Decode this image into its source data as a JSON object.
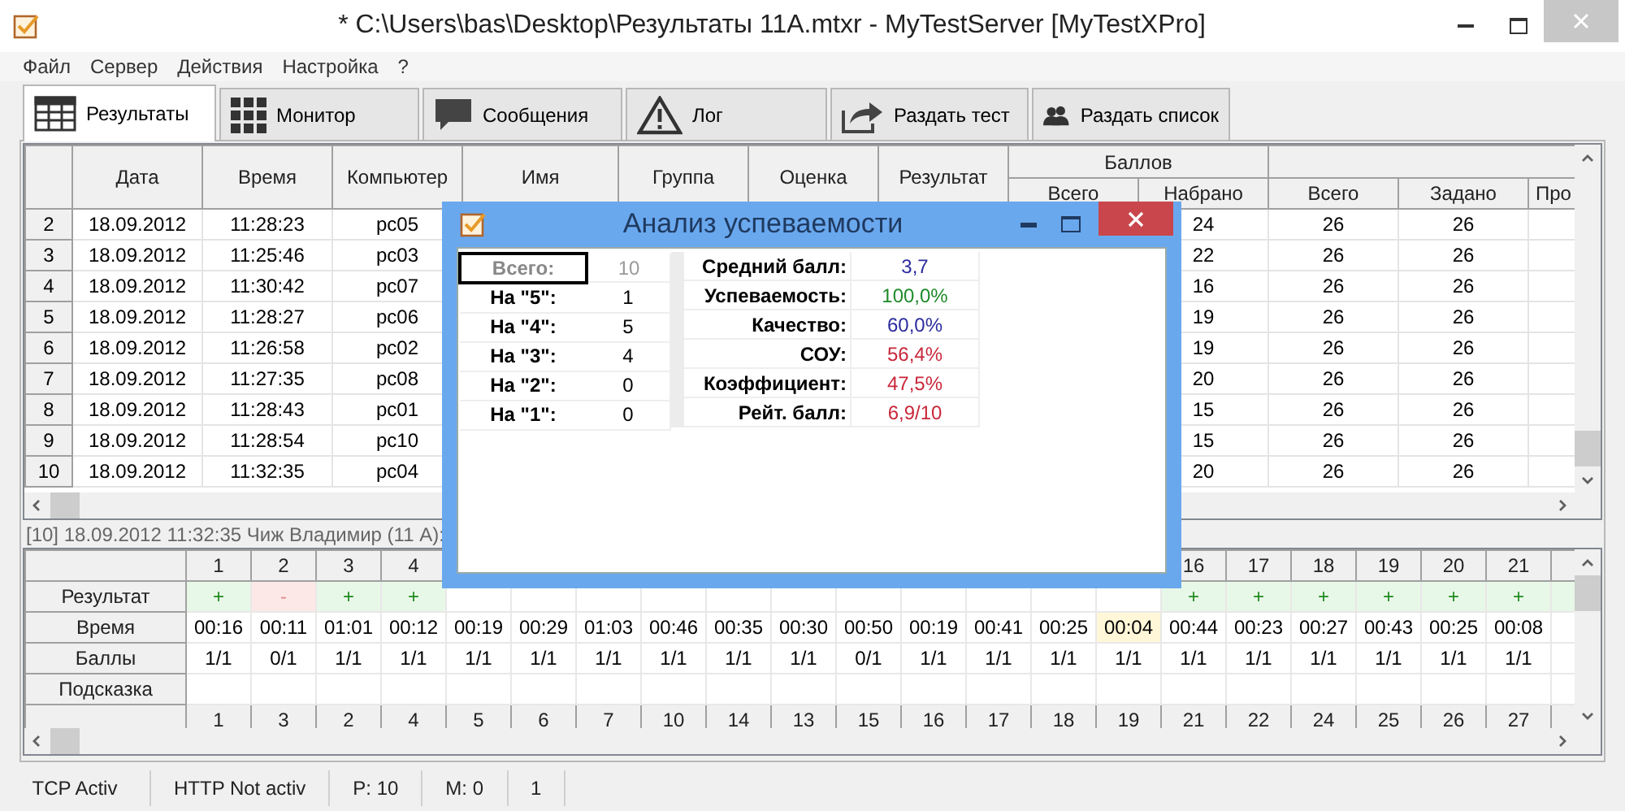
{
  "window": {
    "title": "* C:\\Users\\bas\\Desktop\\Результаты 11А.mtxr - MyTestServer [MyTestXPro]"
  },
  "menu": [
    "Файл",
    "Сервер",
    "Действия",
    "Настройка",
    "?"
  ],
  "tabs": [
    {
      "label": "Результаты",
      "selected": true
    },
    {
      "label": "Монитор",
      "selected": false
    },
    {
      "label": "Сообщения",
      "selected": false
    },
    {
      "label": "Лог",
      "selected": false
    },
    {
      "label": "Раздать тест",
      "selected": false
    },
    {
      "label": "Раздать список",
      "selected": false
    }
  ],
  "results_table": {
    "columns": [
      "Дата",
      "Время",
      "Компьютер",
      "Имя",
      "Группа",
      "Оценка",
      "Результат"
    ],
    "group_header": "Баллов",
    "group_columns": [
      "Всего",
      "Набрано"
    ],
    "extra_columns": [
      "Всего",
      "Задано",
      "Про"
    ],
    "rows": [
      {
        "number": "2",
        "date": "18.09.2012",
        "time": "11:28:23",
        "computer": "pc05",
        "scored": "24",
        "total": "26",
        "assigned": "26"
      },
      {
        "number": "3",
        "date": "18.09.2012",
        "time": "11:25:46",
        "computer": "pc03",
        "scored": "22",
        "total": "26",
        "assigned": "26"
      },
      {
        "number": "4",
        "date": "18.09.2012",
        "time": "11:30:42",
        "computer": "pc07",
        "scored": "16",
        "total": "26",
        "assigned": "26"
      },
      {
        "number": "5",
        "date": "18.09.2012",
        "time": "11:28:27",
        "computer": "pc06",
        "scored": "19",
        "total": "26",
        "assigned": "26"
      },
      {
        "number": "6",
        "date": "18.09.2012",
        "time": "11:26:58",
        "computer": "pc02",
        "scored": "19",
        "total": "26",
        "assigned": "26"
      },
      {
        "number": "7",
        "date": "18.09.2012",
        "time": "11:27:35",
        "computer": "pc08",
        "scored": "20",
        "total": "26",
        "assigned": "26"
      },
      {
        "number": "8",
        "date": "18.09.2012",
        "time": "11:28:43",
        "computer": "pc01",
        "scored": "15",
        "total": "26",
        "assigned": "26"
      },
      {
        "number": "9",
        "date": "18.09.2012",
        "time": "11:28:54",
        "computer": "pc10",
        "scored": "15",
        "total": "26",
        "assigned": "26"
      },
      {
        "number": "10",
        "date": "18.09.2012",
        "time": "11:32:35",
        "computer": "pc04",
        "scored": "20",
        "total": "26",
        "assigned": "26"
      }
    ]
  },
  "record_caption": "[10] 18.09.2012 11:32:35  Чиж Владимир (11 А):",
  "answers": {
    "row_labels": [
      "Результат",
      "Время",
      "Баллы",
      "Подсказка"
    ],
    "questions": [
      {
        "number": "1",
        "result": "+",
        "correct": true,
        "time": "00:16",
        "highlighted": false,
        "score": "1/1",
        "order": "1"
      },
      {
        "number": "2",
        "result": "-",
        "correct": false,
        "time": "00:11",
        "highlighted": false,
        "score": "0/1",
        "order": "3"
      },
      {
        "number": "3",
        "result": "+",
        "correct": true,
        "time": "01:01",
        "highlighted": false,
        "score": "1/1",
        "order": "2"
      },
      {
        "number": "4",
        "result": "+",
        "correct": true,
        "time": "00:12",
        "highlighted": false,
        "score": "1/1",
        "order": "4"
      },
      {
        "time": "00:19",
        "highlighted": false,
        "score": "1/1",
        "order": "5"
      },
      {
        "time": "00:29",
        "highlighted": false,
        "score": "1/1",
        "order": "6"
      },
      {
        "time": "01:03",
        "highlighted": false,
        "score": "1/1",
        "order": "7"
      },
      {
        "time": "00:46",
        "highlighted": false,
        "score": "1/1",
        "order": "10"
      },
      {
        "time": "00:35",
        "highlighted": false,
        "score": "1/1",
        "order": "14"
      },
      {
        "time": "00:30",
        "highlighted": false,
        "score": "1/1",
        "order": "13"
      },
      {
        "time": "00:50",
        "highlighted": false,
        "score": "0/1",
        "order": "15"
      },
      {
        "time": "00:19",
        "highlighted": false,
        "score": "1/1",
        "order": "16"
      },
      {
        "time": "00:41",
        "highlighted": false,
        "score": "1/1",
        "order": "17"
      },
      {
        "time": "00:25",
        "highlighted": false,
        "score": "1/1",
        "order": "18"
      },
      {
        "time": "00:04",
        "highlighted": true,
        "score": "1/1",
        "order": "19"
      },
      {
        "number": "16",
        "result": "+",
        "correct": true,
        "time": "00:44",
        "highlighted": false,
        "score": "1/1",
        "order": "21"
      },
      {
        "number": "17",
        "result": "+",
        "correct": true,
        "time": "00:23",
        "highlighted": false,
        "score": "1/1",
        "order": "22"
      },
      {
        "number": "18",
        "result": "+",
        "correct": true,
        "time": "00:27",
        "highlighted": false,
        "score": "1/1",
        "order": "24"
      },
      {
        "number": "19",
        "result": "+",
        "correct": true,
        "time": "00:43",
        "highlighted": false,
        "score": "1/1",
        "order": "25"
      },
      {
        "number": "20",
        "result": "+",
        "correct": true,
        "time": "00:25",
        "highlighted": false,
        "score": "1/1",
        "order": "26"
      },
      {
        "number": "21",
        "result": "+",
        "correct": true,
        "time": "00:08",
        "highlighted": false,
        "score": "1/1",
        "order": "27"
      }
    ]
  },
  "dialog": {
    "title": "Анализ успеваемости",
    "counts": [
      {
        "label": "Всего:",
        "value": "10",
        "focused": true
      },
      {
        "label": "На \"5\":",
        "value": "1",
        "focused": false
      },
      {
        "label": "На \"4\":",
        "value": "5",
        "focused": false
      },
      {
        "label": "На \"3\":",
        "value": "4",
        "focused": false
      },
      {
        "label": "На \"2\":",
        "value": "0",
        "focused": false
      },
      {
        "label": "На \"1\":",
        "value": "0",
        "focused": false
      }
    ],
    "metrics": [
      {
        "label": "Средний балл:",
        "value": "3,7",
        "color": "#2b2b9e"
      },
      {
        "label": "Успеваемость:",
        "value": "100,0%",
        "color": "#1f8a2a"
      },
      {
        "label": "Качество:",
        "value": "60,0%",
        "color": "#2b2b9e"
      },
      {
        "label": "СОУ:",
        "value": "56,4%",
        "color": "#c8283a"
      },
      {
        "label": "Коэффициент:",
        "value": "47,5%",
        "color": "#c8283a"
      },
      {
        "label": "Рейт. балл:",
        "value": "6,9/10",
        "color": "#c8283a"
      }
    ]
  },
  "status_bar": [
    "TCP Activ",
    "HTTP Not activ",
    "P: 10",
    "M: 0",
    "1"
  ]
}
